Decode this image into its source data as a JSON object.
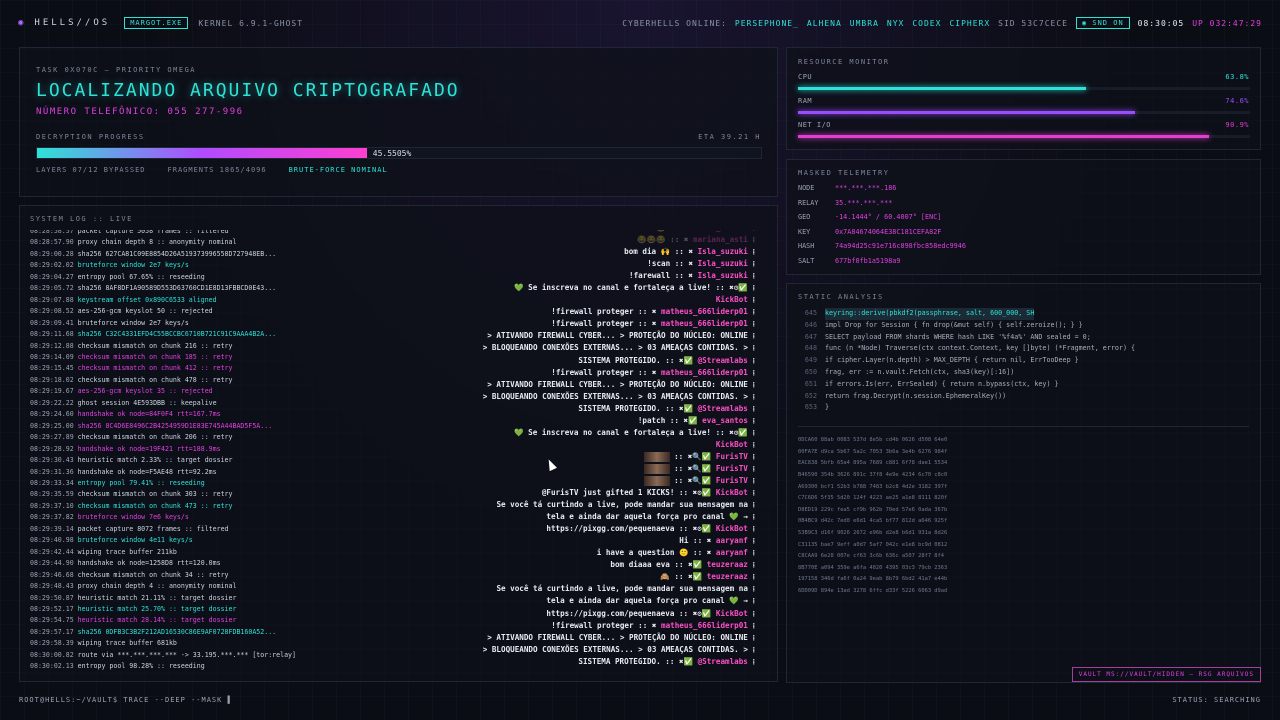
{
  "topbar": {
    "logo_glyph": "◉",
    "brand": "HELLS//OS",
    "tag": "MARGOT.EXE",
    "kernel": "KERNEL 6.9.1-GHOST",
    "online_label": "CYBERHELLS ONLINE:",
    "online_users": [
      "PERSEPHONE_",
      "ALHENA",
      "UMBRA",
      "NYX",
      "CODEX",
      "CIPHERX"
    ],
    "sid": "SID 53C7CECE",
    "snd": "◉ SND ON",
    "clock": "08:30:05",
    "uptime": "UP 032:47:29"
  },
  "task": {
    "label": "TASK 0X070C — PRIORITY OMEGA",
    "title": "LOCALIZANDO ARQUIVO CRIPTOGRAFADO",
    "phone": "NÚMERO TELEFÔNICO: 055 277-996",
    "progress_label": "DECRYPTION PROGRESS",
    "eta": "ETA 39.21 H",
    "progress_pct": 45.5505,
    "progress_text": "45.5505%",
    "layers": "LAYERS 07/12 BYPASSED",
    "fragments": "FRAGMENTS 1865/4096",
    "bruteforce": "BRUTE-FORCE NOMINAL"
  },
  "log": {
    "title": "SYSTEM LOG :: LIVE",
    "lines": [
      {
        "t": "08:28:58.57",
        "m": "packet capture 5058 frames :: filtered",
        "c": ""
      },
      {
        "t": "08:28:57.90",
        "m": "proxy chain depth 8 :: anonymity nominal",
        "c": ""
      },
      {
        "t": "08:29:00.28",
        "m": "sha256 627CA81C09E8854D26A519373996558D727948EB...",
        "c": ""
      },
      {
        "t": "08:29:02.02",
        "m": "bruteforce window 2e7 keys/s",
        "c": "c-cyan"
      },
      {
        "t": "08:29:04.27",
        "m": "entropy pool 67.65% :: reseeding",
        "c": ""
      },
      {
        "t": "08:29:05.72",
        "m": "sha256 8AF8DF1A90589D553D63760CD1E8D13FBBCD0E43...",
        "c": ""
      },
      {
        "t": "08:29:07.88",
        "m": "keystream offset 0x890C6533 aligned",
        "c": "c-cyan"
      },
      {
        "t": "08:29:08.52",
        "m": "aes-256-gcm keyslot 50 :: rejected",
        "c": ""
      },
      {
        "t": "08:29:09.41",
        "m": "bruteforce window 2e7 keys/s",
        "c": ""
      },
      {
        "t": "08:29:11.68",
        "m": "sha256 C32C4331EFD4C55BCCBC6710B721C91C9AAA4B2A...",
        "c": "c-cyan"
      },
      {
        "t": "08:29:12.88",
        "m": "checksum mismatch on chunk 216 :: retry",
        "c": ""
      },
      {
        "t": "08:29:14.09",
        "m": "checksum mismatch on chunk 185 :: retry",
        "c": "c-mag"
      },
      {
        "t": "08:29:15.45",
        "m": "checksum mismatch on chunk 412 :: retry",
        "c": "c-mag"
      },
      {
        "t": "08:29:18.02",
        "m": "checksum mismatch on chunk 478 :: retry",
        "c": ""
      },
      {
        "t": "08:29:19.67",
        "m": "aes-256-gcm keyslot 35 :: rejected",
        "c": "c-mag"
      },
      {
        "t": "08:29:22.22",
        "m": "ghost session 4E593DBB :: keepalive",
        "c": ""
      },
      {
        "t": "08:29:24.60",
        "m": "handshake ok node=84F0F4 rtt=167.7ms",
        "c": "c-mag"
      },
      {
        "t": "08:29:25.00",
        "m": "sha256 8C4D6E8496C2B4254959D1E83E745A44BAD5F5A...",
        "c": "c-mag"
      },
      {
        "t": "08:29:27.89",
        "m": "checksum mismatch on chunk 206 :: retry",
        "c": ""
      },
      {
        "t": "08:29:28.92",
        "m": "handshake ok node=19F421 rtt=188.9ms",
        "c": "c-mag"
      },
      {
        "t": "08:29:30.43",
        "m": "heuristic match 2.33% :: target dossier",
        "c": ""
      },
      {
        "t": "08:29:31.36",
        "m": "handshake ok node=F5AE48 rtt=92.2ms",
        "c": ""
      },
      {
        "t": "08:29:33.34",
        "m": "entropy pool 79.41% :: reseeding",
        "c": "c-cyan"
      },
      {
        "t": "08:29:35.59",
        "m": "checksum mismatch on chunk 303 :: retry",
        "c": ""
      },
      {
        "t": "08:29:37.10",
        "m": "checksum mismatch on chunk 473 :: retry",
        "c": "c-cyan"
      },
      {
        "t": "08:29:37.82",
        "m": "bruteforce window 7e6 keys/s",
        "c": "c-mag"
      },
      {
        "t": "08:29:39.14",
        "m": "packet capture 8072 frames :: filtered",
        "c": ""
      },
      {
        "t": "08:29:40.98",
        "m": "bruteforce window 4e11 keys/s",
        "c": "c-cyan"
      },
      {
        "t": "08:29:42.44",
        "m": "wiping trace buffer 211kb",
        "c": ""
      },
      {
        "t": "08:29:44.90",
        "m": "handshake ok node=1258D8 rtt=120.0ms",
        "c": ""
      },
      {
        "t": "08:29:46.68",
        "m": "checksum mismatch on chunk 34 :: retry",
        "c": ""
      },
      {
        "t": "08:29:48.43",
        "m": "proxy chain depth 4 :: anonymity nominal",
        "c": ""
      },
      {
        "t": "08:29:50.87",
        "m": "heuristic match 21.11% :: target dossier",
        "c": ""
      },
      {
        "t": "08:29:52.17",
        "m": "heuristic match 25.70% :: target dossier",
        "c": "c-cyan"
      },
      {
        "t": "08:29:54.75",
        "m": "heuristic match 28.14% :: target dossier",
        "c": "c-mag"
      },
      {
        "t": "08:29:57.17",
        "m": "sha256 0DFB3C3B2F212AD16530C86E9AF0728FDB160A52...",
        "c": "c-cyan"
      },
      {
        "t": "08:29:58.39",
        "m": "wiping trace buffer 681kb",
        "c": ""
      },
      {
        "t": "08:30:00.82",
        "m": "route via ***.***.***.*** -> 33.195.***.*** [tor:relay]",
        "c": ""
      },
      {
        "t": "08:30:02.13",
        "m": "entropy pool 98.28% :: reseeding",
        "c": ""
      }
    ],
    "chat": [
      {
        "msg": "👑 :: ✖",
        "user": "brune_santos",
        "dim": true
      },
      {
        "msg": "😂😂😂 :: ✖",
        "user": "mariana_asti",
        "dim": true
      },
      {
        "msg": "bom dia 🙌 :: ✖",
        "user": "Isla_suzuki",
        "dim": false
      },
      {
        "msg": "!scan :: ✖",
        "user": "Isla_suzuki",
        "dim": false
      },
      {
        "msg": "!farewall :: ✖",
        "user": "Isla_suzuki",
        "dim": false
      },
      {
        "msg": "💚 Se inscreva no canal e fortaleça a live! :: ✖⚙✅",
        "user": "",
        "dim": false
      },
      {
        "msg": "",
        "user": "KickBot",
        "dim": false
      },
      {
        "msg": "!firewall proteger :: ✖",
        "user": "matheus_666liderp01",
        "dim": false
      },
      {
        "msg": "!firewall proteger :: ✖",
        "user": "matheus_666liderp01",
        "dim": false
      },
      {
        "msg": "> ATIVANDO FIREWALL CYBER... > PROTEÇÃO DO NÚCLEO: ONLINE",
        "user": "",
        "dim": false
      },
      {
        "msg": "> BLOQUEANDO CONEXÕES EXTERNAS... > 03 AMEAÇAS CONTIDAS. >",
        "user": "",
        "dim": false
      },
      {
        "msg": "SISTEMA PROTEGIDO. :: ✖✅",
        "user": "@Streamlabs",
        "dim": false
      },
      {
        "msg": "!firewall proteger :: ✖",
        "user": "matheus_666liderp01",
        "dim": false
      },
      {
        "msg": "> ATIVANDO FIREWALL CYBER... > PROTEÇÃO DO NÚCLEO: ONLINE",
        "user": "",
        "dim": false
      },
      {
        "msg": "> BLOQUEANDO CONEXÕES EXTERNAS... > 03 AMEAÇAS CONTIDAS. >",
        "user": "",
        "dim": false
      },
      {
        "msg": "SISTEMA PROTEGIDO. :: ✖✅",
        "user": "@Streamlabs",
        "dim": false
      },
      {
        "msg": "!patch :: ✖✅",
        "user": "eva_santos",
        "dim": false
      },
      {
        "msg": "💚 Se inscreva no canal e fortaleça a live! :: ✖⚙✅",
        "user": "",
        "dim": false
      },
      {
        "msg": "",
        "user": "KickBot",
        "dim": false
      },
      {
        "msg": "[img] :: ✖🔍✅",
        "user": "FurisTV",
        "dim": false
      },
      {
        "msg": "[img] :: ✖🔍✅",
        "user": "FurisTV",
        "dim": false
      },
      {
        "msg": "[img] :: ✖🔍✅",
        "user": "FurisTV",
        "dim": false
      },
      {
        "msg": "@FurisTV just gifted 1 KICKS! :: ✖⚙✅",
        "user": "KickBot",
        "dim": false
      },
      {
        "msg": "Se você tá curtindo a live, pode mandar sua mensagem na",
        "user": "",
        "dim": false
      },
      {
        "msg": "tela e ainda dar aquela força pro canal 💚 →",
        "user": "",
        "dim": false
      },
      {
        "msg": "https://pixgg.com/pequenaeva :: ✖⚙✅",
        "user": "KickBot",
        "dim": false
      },
      {
        "msg": "Hi :: ✖",
        "user": "aaryanf",
        "dim": false
      },
      {
        "msg": "i have a question 🙂 :: ✖",
        "user": "aaryanf",
        "dim": false
      },
      {
        "msg": "bom diaaa eva :: ✖✅",
        "user": "teuzeraaz",
        "dim": false
      },
      {
        "msg": "🙈 :: ✖✅",
        "user": "teuzeraaz",
        "dim": false
      },
      {
        "msg": "Se você tá curtindo a live, pode mandar sua mensagem na",
        "user": "",
        "dim": false
      },
      {
        "msg": "tela e ainda dar aquela força pro canal 💚 →",
        "user": "",
        "dim": false
      },
      {
        "msg": "https://pixgg.com/pequenaeva :: ✖⚙✅",
        "user": "KickBot",
        "dim": false
      },
      {
        "msg": "!firewall proteger :: ✖",
        "user": "matheus_666liderp01",
        "dim": false
      },
      {
        "msg": "> ATIVANDO FIREWALL CYBER... > PROTEÇÃO DO NÚCLEO: ONLINE",
        "user": "",
        "dim": false
      },
      {
        "msg": "> BLOQUEANDO CONEXÕES EXTERNAS... > 03 AMEAÇAS CONTIDAS. >",
        "user": "",
        "dim": false
      },
      {
        "msg": "SISTEMA PROTEGIDO. :: ✖✅",
        "user": "@Streamlabs",
        "dim": false
      }
    ]
  },
  "resource": {
    "title": "RESOURCE MONITOR",
    "items": [
      {
        "label": "CPU",
        "pct": 63.8,
        "text": "63.8%",
        "color": "#2de2d6"
      },
      {
        "label": "RAM",
        "pct": 74.6,
        "text": "74.6%",
        "color": "#9a4cff"
      },
      {
        "label": "NET I/O",
        "pct": 90.9,
        "text": "90.9%",
        "color": "#e03fd0"
      }
    ]
  },
  "telemetry": {
    "title": "MASKED TELEMETRY",
    "rows": [
      {
        "k": "NODE",
        "v": "***.***.***.186"
      },
      {
        "k": "RELAY",
        "v": "35.***.***.***"
      },
      {
        "k": "GEO",
        "v": "-14.1444° / 60.4007° [ENC]"
      },
      {
        "k": "KEY",
        "v": "0x7A84674064E38C181CEFA82F"
      },
      {
        "k": "HASH",
        "v": "74a94d25c91e716c898fbc858edc9946"
      },
      {
        "k": "SALT",
        "v": "677bf0fb1a5198a9"
      }
    ]
  },
  "static": {
    "title": "STATIC ANALYSIS",
    "code": [
      {
        "n": "645",
        "t": "keyring::derive(pbkdf2(passphrase, salt, 600_000, SH",
        "active": true
      },
      {
        "n": "646",
        "t": "impl Drop for Session { fn drop(&mut self) { self.zeroize(); } }",
        "active": false
      },
      {
        "n": "647",
        "t": "SELECT payload FROM shards WHERE hash LIKE '%f4a%' AND sealed = 0;",
        "active": false
      },
      {
        "n": "648",
        "t": "func (n *Node) Traverse(ctx context.Context, key []byte) (*Fragment, error) {",
        "active": false
      },
      {
        "n": "649",
        "t": "if cipher.Layer(n.depth) > MAX_DEPTH { return nil, ErrTooDeep }",
        "active": false
      },
      {
        "n": "650",
        "t": "frag, err := n.vault.Fetch(ctx, sha3(key)[:16])",
        "active": false
      },
      {
        "n": "651",
        "t": "if errors.Is(err, ErrSealed) { return n.bypass(ctx, key) }",
        "active": false
      },
      {
        "n": "652",
        "t": "return frag.Decrypt(n.session.EphemeralKey())",
        "active": false
      },
      {
        "n": "653",
        "t": "}",
        "active": false
      }
    ],
    "hex": [
      "0DCA60 88ab 0083 537d 8e5b cd4b 0626 d508 64e0",
      "00FA7E d9ca 5b67 5a2c 7053 3b6a 3e4b 6276 984f",
      "EAC838 5bfb 65a4 895a 7689 c881 6f78 dae1 5534",
      "B46590 354b 3626 891c 37f8 4e9e 4234 6c70 c8c0",
      "A69300 bcf1 52b3 b788 7483 b2c8 4d2e 3182 397f",
      "C7C6D6 5f35 5d20 124f 4223 ae25 a1e8 8111 820f",
      "D8ED19 229c fea5 cf9b 962b 70ed 57e6 0ada 367b",
      "0B4BC9 d42c 7ed0 e6d1 4ca5 bf77 812d a646 925f",
      "53B9C3 d16f 9026 2672 e96b d2e8 b6d1 931a 8d26",
      "C31135 bae7 9eff a0d7 5af7 042c e1e8 bc9d 0812",
      "C8CAA9 6e28 007e cf63 3c6b 636c a507 28f7 8f4",
      "8B770E a094 359e a6fa 4020 4395 03c3 79cb 2363",
      "197158 346d fa6f 0a24 9eab 8b79 6bd2 41a7 e44b",
      "6DD09D 894e 13ad 3278 6ffc d33f 5226 6063 d9ad"
    ]
  },
  "vault": "VAULT MS://VAULT/HIDDEN — RSG ARQUIVOS",
  "bottom": {
    "prompt": "ROOT@HELLS:~/VAULT$ TRACE --DEEP --MASK ▌",
    "status": "STATUS: SEARCHING"
  }
}
